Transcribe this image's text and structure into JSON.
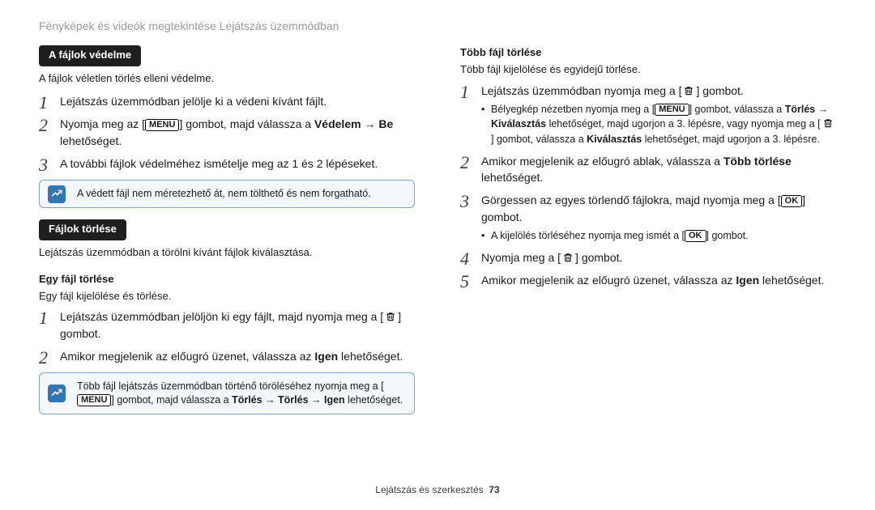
{
  "header": {
    "title": "Fényképek és videók megtekintése Lejátszás üzemmódban"
  },
  "left": {
    "protect": {
      "pill": "A fájlok védelme",
      "intro": "A fájlok véletlen törlés elleni védelme.",
      "s1": "Lejátszás üzemmódban jelölje ki a védeni kívánt fájlt.",
      "s2a": "Nyomja meg az [",
      "s2b": "] gombot, majd válassza a ",
      "s2c": "Védelem → Be",
      "s2d": " lehetőséget.",
      "s3": "A további fájlok védelméhez ismételje meg az 1 és 2 lépéseket.",
      "note": "A védett fájl nem méretezhető át, nem tölthető és nem forgatható."
    },
    "delete": {
      "pill": "Fájlok törlése",
      "intro": "Lejátszás üzemmódban a törölni kívánt fájlok kiválasztása.",
      "one_head": "Egy fájl törlése",
      "one_intro": "Egy fájl kijelölése és törlése.",
      "o1a": "Lejátszás üzemmódban jelöljön ki egy fájlt, majd nyomja meg a [",
      "o1b": "] gombot.",
      "o2a": "Amikor megjelenik az előugró üzenet, válassza az ",
      "o2b": "Igen",
      "o2c": " lehetőséget.",
      "note_a": "Több fájl lejátszás üzemmódban történő töröléséhez nyomja meg a [",
      "note_b": "] gombot, majd válassza a ",
      "note_c": "Törlés → Törlés → Igen",
      "note_d": " lehetőséget."
    }
  },
  "right": {
    "multi_head": "Több fájl törlése",
    "multi_intro": "Több fájl kijelölése és egyidejű törlése.",
    "m1a": "Lejátszás üzemmódban nyomja meg a [",
    "m1b": "] gombot.",
    "m1_sub_a": "Bélyegkép nézetben nyomja meg a [",
    "m1_sub_b": "] gombot, válassza a ",
    "m1_sub_c": "Törlés → Kiválasztás",
    "m1_sub_d": " lehetőséget, majd ugorjon a 3. lépésre, vagy nyomja meg a [",
    "m1_sub_e": "] gombot, válassza a ",
    "m1_sub_f": "Kiválasztás",
    "m1_sub_g": " lehetőséget, majd ugorjon a 3. lépésre.",
    "m2a": "Amikor megjelenik az előugró ablak, válassza a ",
    "m2b": "Több törlése",
    "m2c": " lehetőséget.",
    "m3a": "Görgessen az egyes törlendő fájlokra, majd nyomja meg a [",
    "m3b": "] gombot.",
    "m3_sub_a": "A kijelölés törléséhez nyomja meg ismét a [",
    "m3_sub_b": "] gombot.",
    "m4a": "Nyomja meg a [",
    "m4b": "] gombot.",
    "m5a": "Amikor megjelenik az előugró üzenet, válassza az ",
    "m5b": "Igen",
    "m5c": " lehetőséget."
  },
  "buttons": {
    "menu": "MENU",
    "ok": "OK"
  },
  "footer": {
    "section": "Lejátszás és szerkesztés",
    "page": "73"
  }
}
